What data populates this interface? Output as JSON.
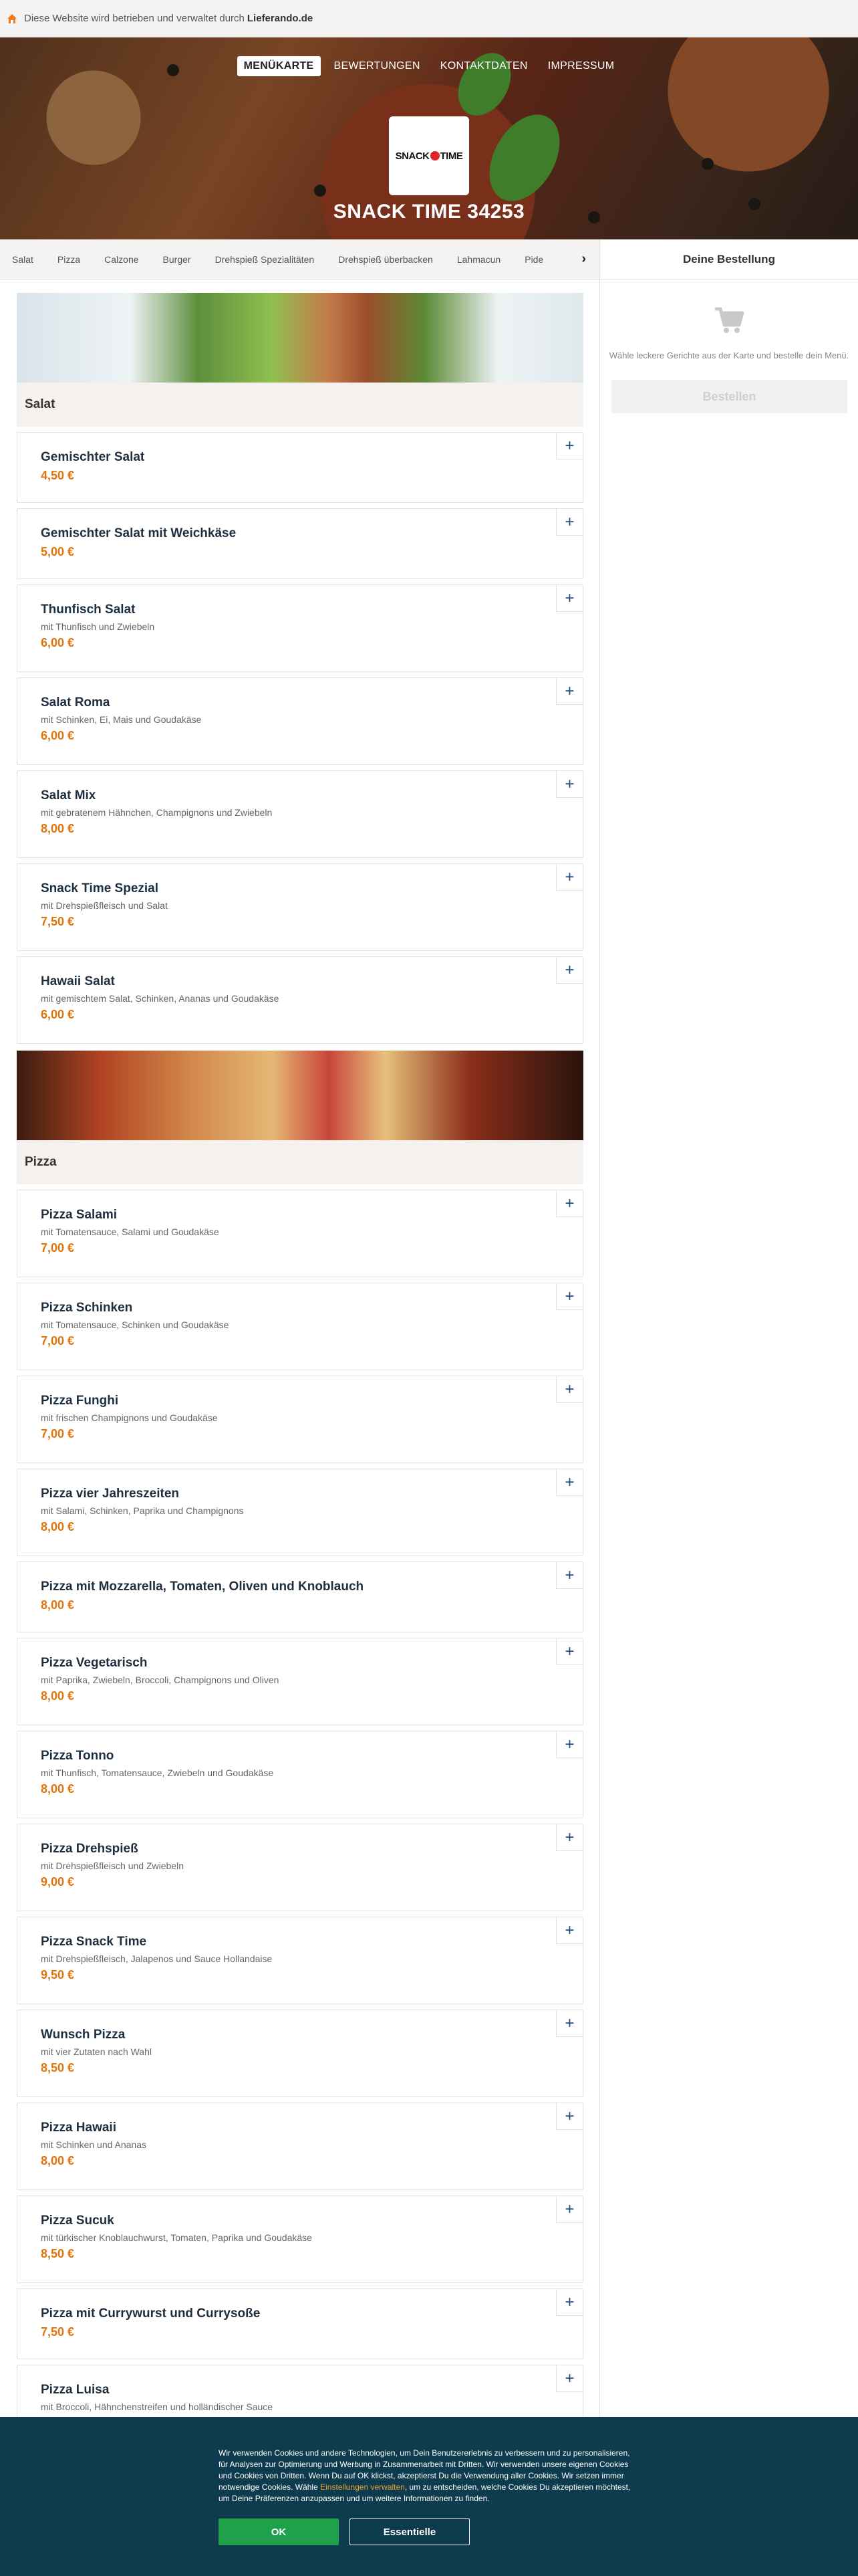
{
  "topbar": {
    "prefix": "Diese Website wird betrieben und verwaltet durch",
    "brand": "Lieferando.de"
  },
  "nav": [
    "MENÜKARTE",
    "BEWERTUNGEN",
    "KONTAKTDATEN",
    "IMPRESSUM"
  ],
  "logo": {
    "left": "SNACK",
    "right": "TIME"
  },
  "shop_name": "SNACK TIME 34253",
  "categories": [
    "Salat",
    "Pizza",
    "Calzone",
    "Burger",
    "Drehspieß Spezialitäten",
    "Drehspieß überbacken",
    "Lahmacun",
    "Pide"
  ],
  "sections": [
    {
      "title": "Salat",
      "banner": "salad",
      "items": [
        {
          "name": "Gemischter Salat",
          "desc": "",
          "price": "4,50 €"
        },
        {
          "name": "Gemischter Salat mit Weichkäse",
          "desc": "",
          "price": "5,00 €"
        },
        {
          "name": "Thunfisch Salat",
          "desc": "mit Thunfisch und Zwiebeln",
          "price": "6,00 €"
        },
        {
          "name": "Salat Roma",
          "desc": "mit Schinken, Ei, Mais und Goudakäse",
          "price": "6,00 €"
        },
        {
          "name": "Salat Mix",
          "desc": "mit gebratenem Hähnchen, Champignons und Zwiebeln",
          "price": "8,00 €"
        },
        {
          "name": "Snack Time Spezial",
          "desc": "mit Drehspießfleisch und Salat",
          "price": "7,50 €"
        },
        {
          "name": "Hawaii Salat",
          "desc": "mit gemischtem Salat, Schinken, Ananas und Goudakäse",
          "price": "6,00 €"
        }
      ]
    },
    {
      "title": "Pizza",
      "banner": "pizza",
      "items": [
        {
          "name": "Pizza Salami",
          "desc": "mit Tomatensauce, Salami und Goudakäse",
          "price": "7,00 €"
        },
        {
          "name": "Pizza Schinken",
          "desc": "mit Tomatensauce, Schinken und Goudakäse",
          "price": "7,00 €"
        },
        {
          "name": "Pizza Funghi",
          "desc": "mit frischen Champignons und Goudakäse",
          "price": "7,00 €"
        },
        {
          "name": "Pizza vier Jahreszeiten",
          "desc": "mit Salami, Schinken, Paprika und Champignons",
          "price": "8,00 €"
        },
        {
          "name": "Pizza mit Mozzarella, Tomaten, Oliven und Knoblauch",
          "desc": "",
          "price": "8,00 €"
        },
        {
          "name": "Pizza Vegetarisch",
          "desc": "mit Paprika, Zwiebeln, Broccoli, Champignons und Oliven",
          "price": "8,00 €"
        },
        {
          "name": "Pizza Tonno",
          "desc": "mit Thunfisch, Tomatensauce, Zwiebeln und Goudakäse",
          "price": "8,00 €"
        },
        {
          "name": "Pizza Drehspieß",
          "desc": "mit Drehspießfleisch und Zwiebeln",
          "price": "9,00 €"
        },
        {
          "name": "Pizza Snack Time",
          "desc": "mit Drehspießfleisch, Jalapenos und Sauce Hollandaise",
          "price": "9,50 €"
        },
        {
          "name": "Wunsch Pizza",
          "desc": "mit vier Zutaten nach Wahl",
          "price": "8,50 €"
        },
        {
          "name": "Pizza Hawaii",
          "desc": "mit Schinken und Ananas",
          "price": "8,00 €"
        },
        {
          "name": "Pizza Sucuk",
          "desc": "mit türkischer Knoblauchwurst, Tomaten, Paprika und Goudakäse",
          "price": "8,50 €"
        },
        {
          "name": "Pizza mit Currywurst und Currysoße",
          "desc": "",
          "price": "7,50 €"
        },
        {
          "name": "Pizza Luisa",
          "desc": "mit Broccoli, Hähnchenstreifen und holländischer Sauce",
          "price": ""
        }
      ]
    }
  ],
  "sidebar": {
    "title": "Deine Bestellung",
    "hint": "Wähle leckere Gerichte aus der Karte und bestelle dein Menü.",
    "order_button": "Bestellen",
    "cart_icon": "cart-icon"
  },
  "cookie": {
    "text_1": "Wir verwenden Cookies und andere Technologien, um Dein Benutzererlebnis zu verbessern und zu personalisieren, für Analysen zur Optimierung und Werbung in Zusammenarbeit mit Dritten. Wir verwenden unsere eigenen Cookies und Cookies von Dritten. Wenn Du auf OK klickst, akzeptierst Du die Verwendung aller Cookies. Wir setzen immer notwendige Cookies. Wähle ",
    "link": "Einstellungen verwalten",
    "text_2": ", um zu entscheiden, welche Cookies Du akzeptieren möchtest, um Deine Präferenzen anzupassen und um weitere Informationen zu finden.",
    "ok_label": "OK",
    "essential_label": "Essentielle"
  },
  "colors": {
    "accent_price": "#e0740a",
    "add_icon": "#1f4e8c",
    "cookie_bg": "#0e3b4d",
    "ok_bg": "#1fa04a"
  }
}
